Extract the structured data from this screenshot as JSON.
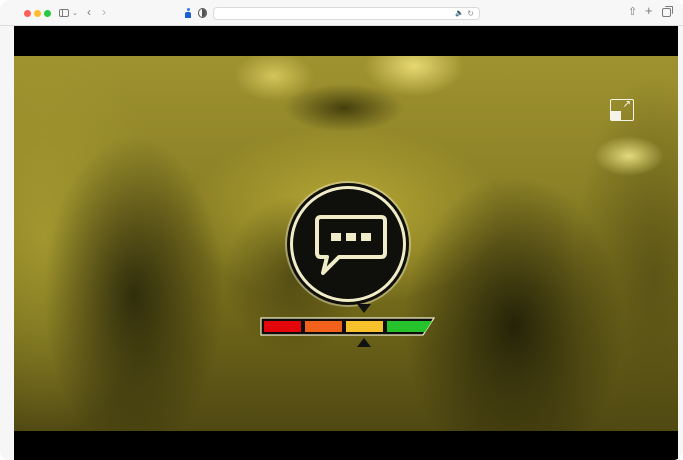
{
  "browser": {
    "window_controls": [
      "close",
      "minimize",
      "maximize"
    ],
    "toolbar_icons": {
      "sidebar": "sidebar-icon",
      "back": "chevron-left-icon",
      "forward": "chevron-right-icon",
      "privacy": "person-icon",
      "shield": "shield-icon",
      "share": "share-icon",
      "new_tab": "plus-icon",
      "tabs": "tabs-icon"
    },
    "address_bar": {
      "url": "",
      "audio_icon": "speaker-icon",
      "reload_icon": "reload-icon"
    }
  },
  "video": {
    "expand_icon": "expand-icon",
    "speech_badge_icon": "chat-bubble-icon",
    "meter": {
      "segments": [
        {
          "name": "red",
          "color": "#e3060a"
        },
        {
          "name": "orange",
          "color": "#f2611b"
        },
        {
          "name": "yellow",
          "color": "#f7c12b"
        },
        {
          "name": "green",
          "color": "#26c22c"
        }
      ],
      "selected_segment_index": 2,
      "marker_icons": [
        "triangle-down-icon",
        "triangle-up-icon"
      ]
    },
    "tint_color": "#8c8126"
  }
}
